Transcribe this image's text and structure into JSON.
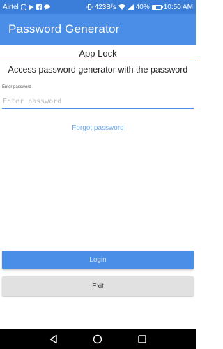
{
  "status_bar": {
    "carrier": "Airtel",
    "network_speed": "423B/s",
    "battery_percent": "40%",
    "battery_level": 0.4,
    "time": "10:50 AM",
    "icons": [
      "sim-icon",
      "shield-icon",
      "play-icon",
      "facebook-icon",
      "chat-icon",
      "vibrate-icon",
      "wifi-icon",
      "signal-icon",
      "battery-icon"
    ]
  },
  "app_bar": {
    "title": "Password Generator"
  },
  "lock": {
    "title": "App Lock",
    "subtitle": "Access password generator with the password",
    "field_label": "Enter password",
    "field_placeholder": "Enter password",
    "field_value": "",
    "forgot_label": "Forgot password"
  },
  "buttons": {
    "login_label": "Login",
    "exit_label": "Exit"
  },
  "colors": {
    "status_bar": "#3a7ed9",
    "primary": "#4a8ee8",
    "link": "#6aa7f0",
    "secondary_button": "#e1e1e1",
    "nav_bar": "#000000"
  },
  "nav_bar": {
    "icons": [
      "back-icon",
      "home-icon",
      "recents-icon"
    ]
  }
}
